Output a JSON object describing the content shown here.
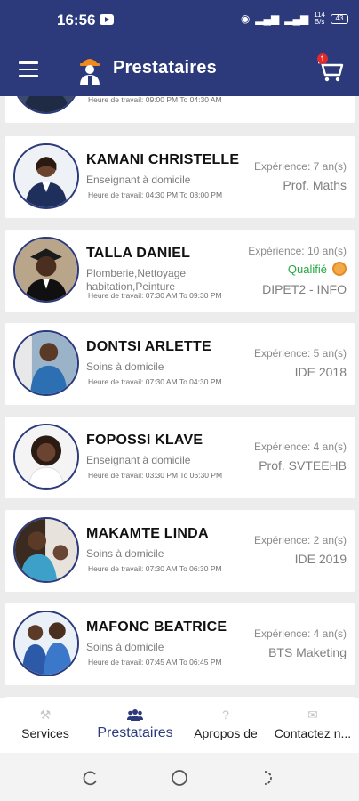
{
  "status_bar": {
    "time": "16:56",
    "speed": "114\nB/s",
    "battery": "43"
  },
  "app_bar": {
    "title": "Prestataires",
    "cart_count": "1"
  },
  "providers": [
    {
      "name": "",
      "service": "",
      "hours": "Heure de travail: 09:00 PM To 04:30 AM",
      "experience": "",
      "specialty": "",
      "qualified": ""
    },
    {
      "name": "KAMANI CHRISTELLE",
      "service": "Enseignant à domicile",
      "hours": "Heure de travail: 04:30 PM To 08:00 PM",
      "experience": "Expérience: 7 an(s)",
      "specialty": "Prof. Maths",
      "qualified": ""
    },
    {
      "name": "TALLA DANIEL",
      "service": "Plomberie,Nettoyage habitation,Peinture",
      "hours": "Heure de travail: 07:30 AM To 09:30 PM",
      "experience": "Expérience: 10 an(s)",
      "specialty": "DIPET2 - INFO",
      "qualified": "Qualifié"
    },
    {
      "name": "DONTSI ARLETTE",
      "service": "Soins à domicile",
      "hours": "Heure de travail: 07:30 AM To 04:30 PM",
      "experience": "Expérience: 5 an(s)",
      "specialty": "IDE 2018",
      "qualified": ""
    },
    {
      "name": "FOPOSSI KLAVE",
      "service": "Enseignant à domicile",
      "hours": "Heure de travail: 03:30 PM To 06:30 PM",
      "experience": "Expérience: 4 an(s)",
      "specialty": "Prof. SVTEEHB",
      "qualified": ""
    },
    {
      "name": "MAKAMTE LINDA",
      "service": "Soins à domicile",
      "hours": "Heure de travail: 07:30 AM To 06:30 PM",
      "experience": "Expérience: 2 an(s)",
      "specialty": "IDE 2019",
      "qualified": ""
    },
    {
      "name": "MAFONC BEATRICE",
      "service": "Soins à domicile",
      "hours": "Heure de travail: 07:45 AM To 06:45 PM",
      "experience": "Expérience: 4 an(s)",
      "specialty": "BTS Maketing",
      "qualified": ""
    }
  ],
  "bottom_nav": [
    {
      "label": "Services",
      "icon": "wrench-icon"
    },
    {
      "label": "Prestataires",
      "icon": "people-icon"
    },
    {
      "label": "Apropos de",
      "icon": "question-icon"
    },
    {
      "label": "Contactez n...",
      "icon": "mail-icon"
    }
  ],
  "colors": {
    "primary": "#2c3a7c",
    "qualified": "#28a745",
    "badge": "#e02b2b"
  }
}
